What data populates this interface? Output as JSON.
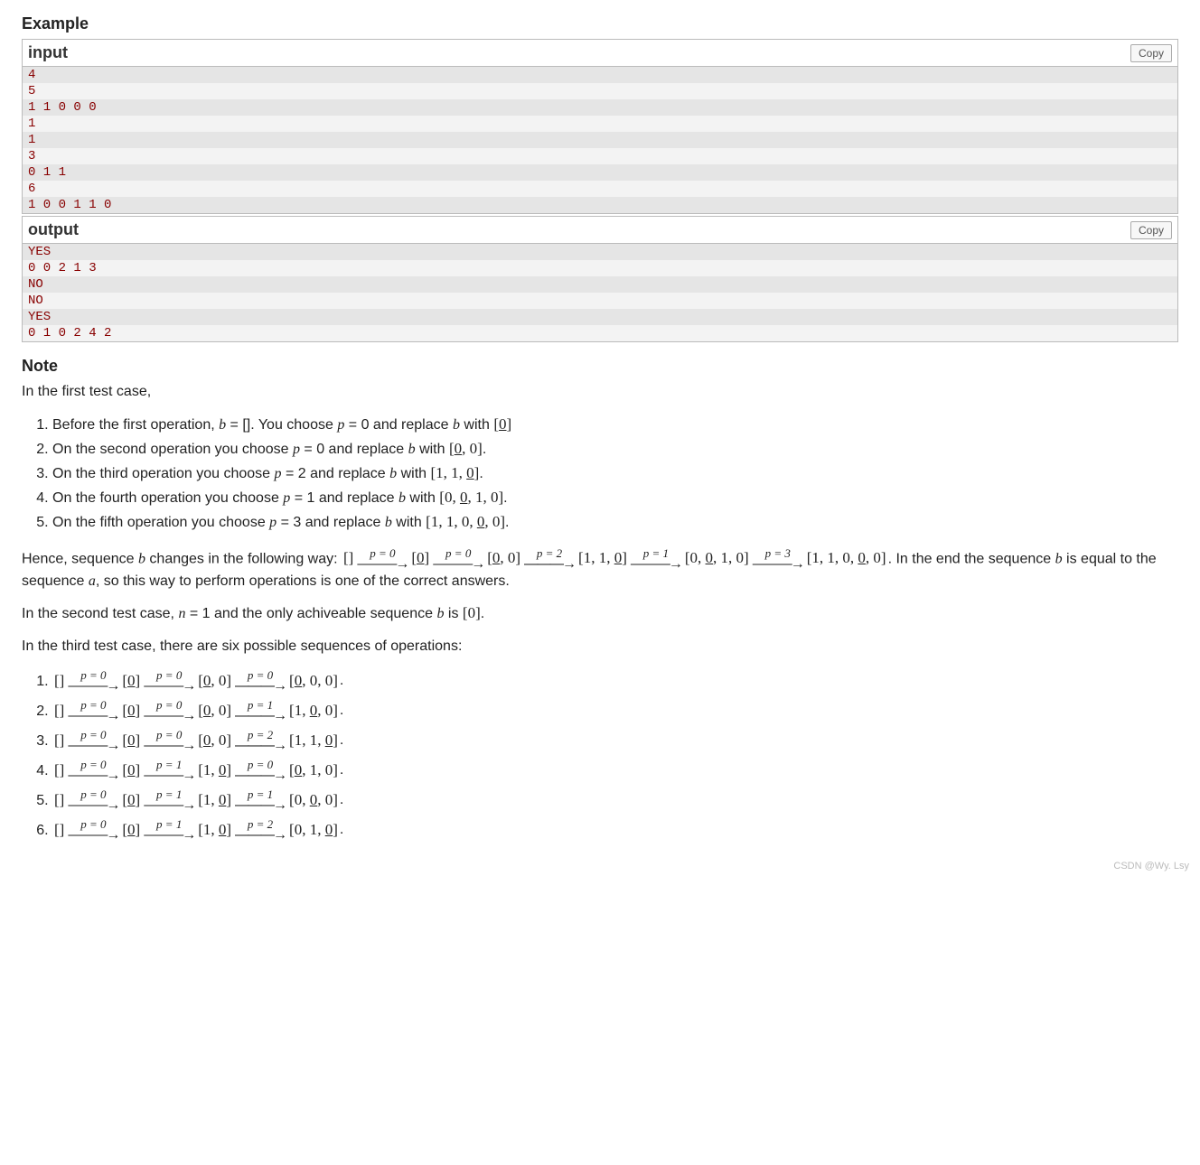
{
  "example_title": "Example",
  "input_label": "input",
  "output_label": "output",
  "copy_label": "Copy",
  "input_lines": [
    "4",
    "5",
    "1 1 0 0 0",
    "1",
    "1",
    "3",
    "0 1 1",
    "6",
    "1 0 0 1 1 0"
  ],
  "output_lines": [
    "YES",
    "0 0 2 1 3",
    "NO",
    "NO",
    "YES",
    "0 1 0 2 4 2"
  ],
  "note_title": "Note",
  "note_intro": "In the first test case,",
  "steps": [
    {
      "pre": "Before the first operation, ",
      "b_eq": "b = []",
      "mid": ". You choose ",
      "p_eq": "p = 0",
      "mid2": " and replace ",
      "bvar": "b",
      "with": " with ",
      "arr": "[0]",
      "und": [
        0
      ]
    },
    {
      "pre": "On the second operation you choose ",
      "p_eq": "p = 0",
      "mid2": " and replace ",
      "bvar": "b",
      "with": " with ",
      "arr": "[0, 0]",
      "und": [
        0
      ],
      "post": "."
    },
    {
      "pre": "On the third operation you choose ",
      "p_eq": "p = 2",
      "mid2": " and replace ",
      "bvar": "b",
      "with": " with ",
      "arr": "[1, 1, 0]",
      "und": [
        2
      ],
      "post": "."
    },
    {
      "pre": "On the fourth operation you choose ",
      "p_eq": "p = 1",
      "mid2": " and replace ",
      "bvar": "b",
      "with": " with ",
      "arr": "[0, 0, 1, 0]",
      "und": [
        1
      ],
      "post": "."
    },
    {
      "pre": "On the fifth operation you choose ",
      "p_eq": "p = 3",
      "mid2": " and replace ",
      "bvar": "b",
      "with": " with ",
      "arr": "[1, 1, 0, 0, 0]",
      "und": [
        3
      ],
      "post": "."
    }
  ],
  "hence_pre": "Hence, sequence ",
  "hence_mid": " changes in the following way: ",
  "chain": [
    {
      "arr": "[]",
      "und": []
    },
    {
      "p": "p = 0",
      "arr": "[0]",
      "und": [
        0
      ]
    },
    {
      "p": "p = 0",
      "arr": "[0, 0]",
      "und": [
        0
      ]
    },
    {
      "p": "p = 2",
      "arr": "[1, 1, 0]",
      "und": [
        2
      ]
    },
    {
      "p": "p = 1",
      "arr": "[0, 0, 1, 0]",
      "und": [
        1
      ]
    },
    {
      "p": "p = 3",
      "arr": "[1, 1, 0, 0, 0]",
      "und": [
        3
      ]
    }
  ],
  "hence_tail": ". In the end the sequence ",
  "hence_tail2": " is equal to the sequence ",
  "hence_tail3": ", so this way to perform operations is one of the correct answers.",
  "second_case_pre": "In the second test case, ",
  "second_case_eq": "n = 1",
  "second_case_mid": " and the only achiveable sequence ",
  "second_case_b": "b",
  "second_case_is": " is ",
  "second_case_arr": "[0]",
  "second_case_post": ".",
  "third_case": "In the third test case, there are six possible sequences of operations:",
  "seqs": [
    [
      {
        "arr": "[]",
        "und": []
      },
      {
        "p": "p = 0",
        "arr": "[0]",
        "und": [
          0
        ]
      },
      {
        "p": "p = 0",
        "arr": "[0, 0]",
        "und": [
          0
        ]
      },
      {
        "p": "p = 0",
        "arr": "[0, 0, 0]",
        "und": [
          0
        ]
      }
    ],
    [
      {
        "arr": "[]",
        "und": []
      },
      {
        "p": "p = 0",
        "arr": "[0]",
        "und": [
          0
        ]
      },
      {
        "p": "p = 0",
        "arr": "[0, 0]",
        "und": [
          0
        ]
      },
      {
        "p": "p = 1",
        "arr": "[1, 0, 0]",
        "und": [
          1
        ]
      }
    ],
    [
      {
        "arr": "[]",
        "und": []
      },
      {
        "p": "p = 0",
        "arr": "[0]",
        "und": [
          0
        ]
      },
      {
        "p": "p = 0",
        "arr": "[0, 0]",
        "und": [
          0
        ]
      },
      {
        "p": "p = 2",
        "arr": "[1, 1, 0]",
        "und": [
          2
        ]
      }
    ],
    [
      {
        "arr": "[]",
        "und": []
      },
      {
        "p": "p = 0",
        "arr": "[0]",
        "und": [
          0
        ]
      },
      {
        "p": "p = 1",
        "arr": "[1, 0]",
        "und": [
          1
        ]
      },
      {
        "p": "p = 0",
        "arr": "[0, 1, 0]",
        "und": [
          0
        ]
      }
    ],
    [
      {
        "arr": "[]",
        "und": []
      },
      {
        "p": "p = 0",
        "arr": "[0]",
        "und": [
          0
        ]
      },
      {
        "p": "p = 1",
        "arr": "[1, 0]",
        "und": [
          1
        ]
      },
      {
        "p": "p = 1",
        "arr": "[0, 0, 0]",
        "und": [
          1
        ]
      }
    ],
    [
      {
        "arr": "[]",
        "und": []
      },
      {
        "p": "p = 0",
        "arr": "[0]",
        "und": [
          0
        ]
      },
      {
        "p": "p = 1",
        "arr": "[1, 0]",
        "und": [
          1
        ]
      },
      {
        "p": "p = 2",
        "arr": "[0, 1, 0]",
        "und": [
          2
        ]
      }
    ]
  ],
  "watermark": "CSDN @Wy. Lsy"
}
